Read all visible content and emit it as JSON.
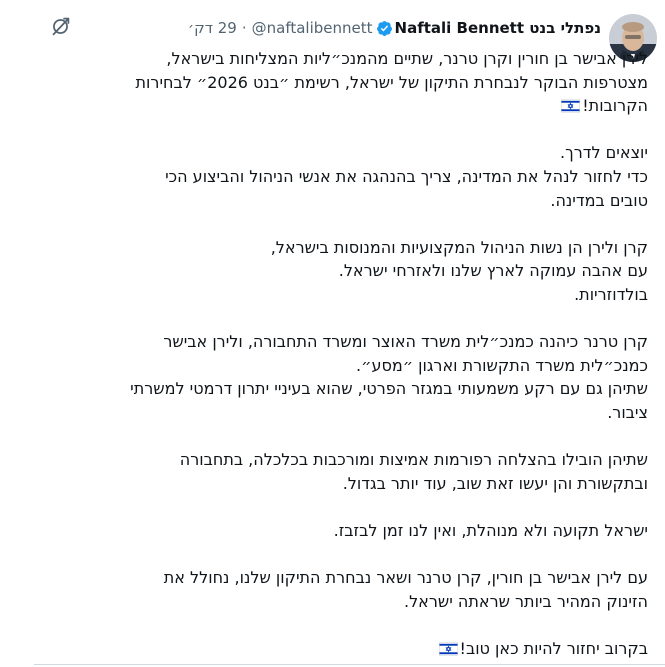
{
  "tweet": {
    "author_name": "Naftali Bennett נפתלי בנט",
    "handle": "@naftalibennett",
    "separator": "·",
    "time": "29 דק׳",
    "paragraphs": [
      {
        "lines": [
          "לירן אבישר בן חורין וקרן טרנר, שתיים מהמנכ״ליות המצליחות בישראל,",
          "מצטרפות הבוקר לנבחרת התיקון של ישראל, רשימת ״בנט 2026״ לבחירות",
          "הקרובות!"
        ],
        "flag_after_line": 2
      },
      {
        "lines": [
          "יוצאים לדרך.",
          "כדי לחזור לנהל את המדינה, צריך בהנהגה את אנשי הניהול והביצוע הכי",
          "טובים במדינה."
        ]
      },
      {
        "lines": [
          "קרן ולירן הן נשות הניהול המקצועיות והמנוסות בישראל,",
          "עם אהבה עמוקה לארץ שלנו ולאזרחי ישראל.",
          "בולדוזריות."
        ]
      },
      {
        "lines": [
          "קרן טרנר כיהנה כמנכ״לית משרד האוצר ומשרד התחבורה, ולירן אבישר",
          "כמנכ״לית משרד התקשורת וארגון ״מסע״.",
          "שתיהן גם עם רקע משמעותי במגזר הפרטי, שהוא בעיניי יתרון דרמטי למשרתי",
          "ציבור."
        ]
      },
      {
        "lines": [
          "שתיהן הובילו בהצלחה רפורמות אמיצות ומורכבות בכלכלה, בתחבורה",
          "ובתקשורת והן יעשו זאת שוב, עוד יותר בגדול."
        ]
      },
      {
        "lines": [
          "ישראל תקועה ולא מנוהלת, ואין לנו זמן לבזבז."
        ]
      },
      {
        "lines": [
          "עם לירן אבישר בן חורין, קרן טרנר ושאר נבחרת התיקון שלנו, נחולל את",
          "הזינוק המהיר ביותר שראתה ישראל."
        ]
      },
      {
        "lines": [
          "בקרוב יחזור להיות כאן טוב!"
        ],
        "flag_after_line": 0
      }
    ]
  },
  "icons": {
    "verified": "verified-badge-icon",
    "grok": "grok-icon",
    "flag": "israel-flag-icon"
  },
  "colors": {
    "text": "#0f1419",
    "secondary": "#536471",
    "verified": "#1d9bf0",
    "flag_blue": "#0038b8"
  }
}
